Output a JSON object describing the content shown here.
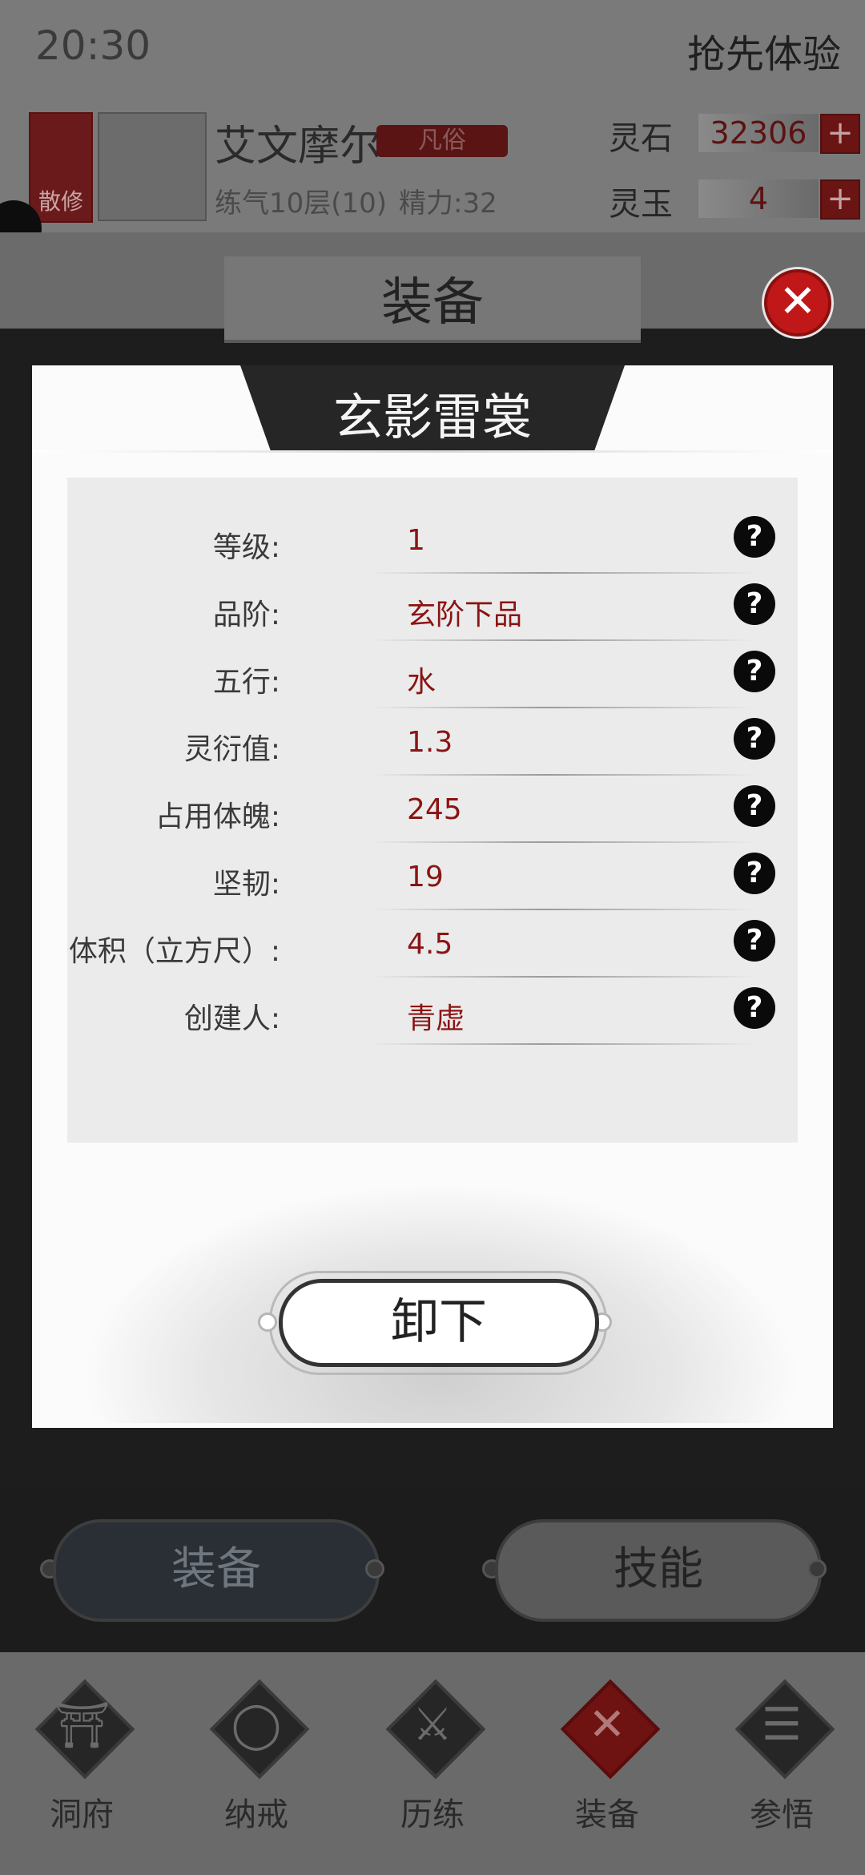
{
  "status_bar": {
    "time": "20:30"
  },
  "header": {
    "preview_label": "抢先体验",
    "sect_badge": "散修",
    "player_name": "艾文摩尔",
    "rank_badge": "凡俗",
    "realm": "练气10层(10)",
    "energy": "精力:32",
    "currencies": [
      {
        "label": "灵石",
        "value": "32306",
        "add": "+"
      },
      {
        "label": "灵玉",
        "value": "4",
        "add": "+"
      }
    ]
  },
  "screen": {
    "title": "装备",
    "close": "✕"
  },
  "item": {
    "name": "玄影雷裳",
    "stats": [
      {
        "label": "等级:",
        "value": "1"
      },
      {
        "label": "品阶:",
        "value": "玄阶下品"
      },
      {
        "label": "五行:",
        "value": "水"
      },
      {
        "label": "灵衍值:",
        "value": "1.3"
      },
      {
        "label": "占用体魄:",
        "value": "245"
      },
      {
        "label": "坚韧:",
        "value": "19"
      },
      {
        "label": "体积（立方尺）:",
        "value": "4.5"
      },
      {
        "label": "创建人:",
        "value": "青虚"
      }
    ],
    "help_icon": "?",
    "unequip_label": "卸下"
  },
  "tabs": {
    "equip_label": "装备",
    "skill_label": "技能"
  },
  "bottom_nav": [
    {
      "label": "洞府",
      "icon": "cave-icon",
      "glyph": "⛩",
      "active": false
    },
    {
      "label": "纳戒",
      "icon": "ring-icon",
      "glyph": "◯",
      "active": false
    },
    {
      "label": "历练",
      "icon": "swords-icon",
      "glyph": "⚔",
      "active": false
    },
    {
      "label": "装备",
      "icon": "equip-icon",
      "glyph": "✕",
      "active": true
    },
    {
      "label": "参悟",
      "icon": "book-icon",
      "glyph": "☰",
      "active": false
    }
  ],
  "colors": {
    "accent_red": "#c01818",
    "value_red": "#8b1414",
    "dark": "#262626"
  }
}
